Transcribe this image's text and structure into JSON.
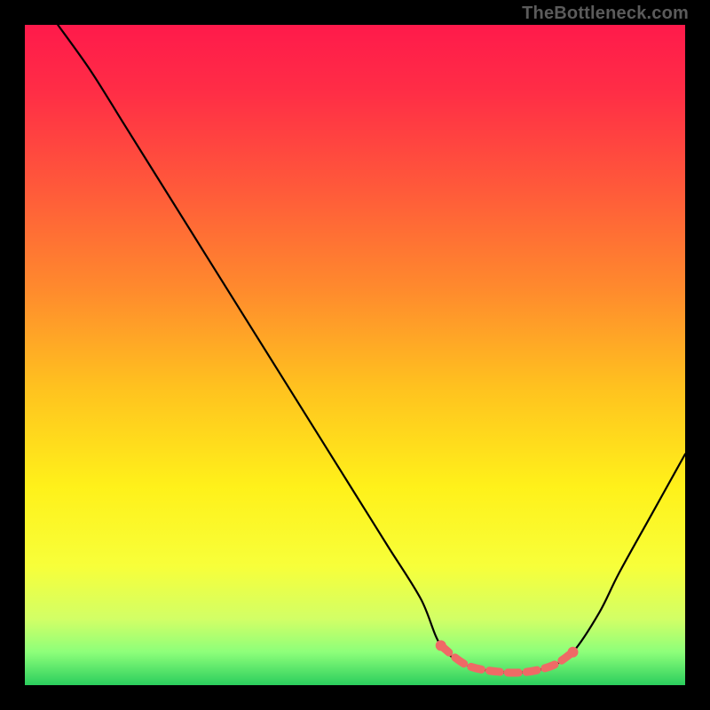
{
  "attribution": "TheBottleneck.com",
  "chart_data": {
    "type": "line",
    "title": "",
    "xlabel": "",
    "ylabel": "",
    "xlim": [
      0,
      100
    ],
    "ylim": [
      0,
      100
    ],
    "grid": false,
    "series": [
      {
        "name": "bottleneck-curve",
        "color": "#000000",
        "x": [
          5,
          10,
          15,
          20,
          25,
          30,
          35,
          40,
          45,
          50,
          55,
          60,
          63,
          67,
          72,
          76,
          80,
          83,
          87,
          90,
          95,
          100
        ],
        "y": [
          100,
          93,
          85,
          77,
          69,
          61,
          53,
          45,
          37,
          29,
          21,
          13,
          6,
          3,
          2,
          2,
          3,
          5,
          11,
          17,
          26,
          35
        ]
      },
      {
        "name": "optimal-segment",
        "color": "#ef6a66",
        "dashed": true,
        "x": [
          63,
          67,
          72,
          76,
          80,
          83
        ],
        "y": [
          6,
          3,
          2,
          2,
          3,
          5
        ]
      }
    ],
    "background_gradient": {
      "stops": [
        {
          "offset": 0.0,
          "color": "#ff1a4b"
        },
        {
          "offset": 0.1,
          "color": "#ff2d46"
        },
        {
          "offset": 0.25,
          "color": "#ff5a3a"
        },
        {
          "offset": 0.4,
          "color": "#ff8a2d"
        },
        {
          "offset": 0.55,
          "color": "#ffc21f"
        },
        {
          "offset": 0.7,
          "color": "#fff11a"
        },
        {
          "offset": 0.82,
          "color": "#f7ff3a"
        },
        {
          "offset": 0.9,
          "color": "#d2ff66"
        },
        {
          "offset": 0.95,
          "color": "#8dff7a"
        },
        {
          "offset": 1.0,
          "color": "#2bce5d"
        }
      ]
    }
  }
}
